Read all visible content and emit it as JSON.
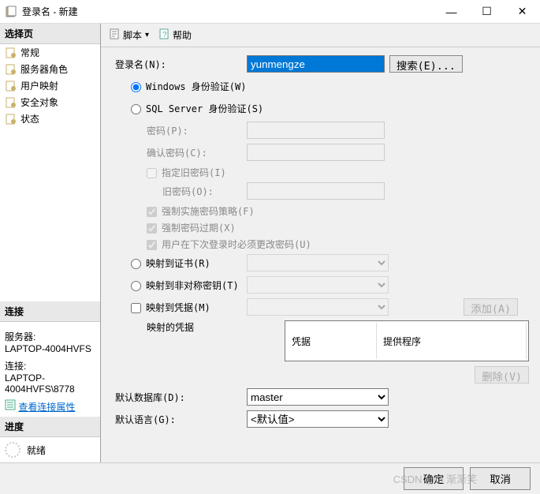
{
  "window": {
    "title": "登录名 - 新建",
    "minimize": "—",
    "maximize": "☐",
    "close": "✕"
  },
  "sidebar": {
    "select_page": "选择页",
    "items": [
      {
        "label": "常规"
      },
      {
        "label": "服务器角色"
      },
      {
        "label": "用户映射"
      },
      {
        "label": "安全对象"
      },
      {
        "label": "状态"
      }
    ],
    "connection_title": "连接",
    "server_label": "服务器:",
    "server_value": "LAPTOP-4004HVFS",
    "conn_label": "连接:",
    "conn_value": "LAPTOP-4004HVFS\\8778",
    "view_props": "查看连接属性",
    "progress_title": "进度",
    "ready": "就绪"
  },
  "toolbar": {
    "script": "脚本",
    "help": "帮助"
  },
  "form": {
    "login_name_label": "登录名(N):",
    "login_name_value": "yunmengze",
    "search_btn": "搜索(E)...",
    "windows_auth": "Windows 身份验证(W)",
    "sql_auth": "SQL Server 身份验证(S)",
    "password_label": "密码(P):",
    "confirm_password_label": "确认密码(C):",
    "specify_old_pw": "指定旧密码(I)",
    "old_password_label": "旧密码(O):",
    "enforce_policy": "强制实施密码策略(F)",
    "enforce_expiry": "强制密码过期(X)",
    "must_change": "用户在下次登录时必须更改密码(U)",
    "map_cert": "映射到证书(R)",
    "map_asym": "映射到非对称密钥(T)",
    "map_cred": "映射到凭据(M)",
    "add_btn": "添加(A)",
    "mapped_creds": "映射的凭据",
    "cred_col1": "凭据",
    "cred_col2": "提供程序",
    "remove_btn": "删除(V)",
    "default_db_label": "默认数据库(D):",
    "default_db_value": "master",
    "default_lang_label": "默认语言(G):",
    "default_lang_value": "<默认值>"
  },
  "footer": {
    "ok": "确定",
    "cancel": "取消",
    "watermark": "CSDN @ω 渐渐笑"
  }
}
